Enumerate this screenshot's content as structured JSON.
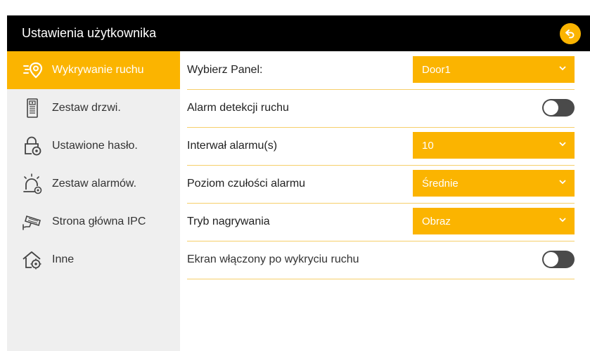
{
  "header": {
    "title": "Ustawienia użytkownika",
    "back_icon": "back-arrow-icon"
  },
  "colors": {
    "accent": "#fbb400",
    "header_bg": "#000000",
    "sidebar_bg": "#efefef",
    "divider": "#f6cf6a",
    "toggle_off": "#4a4a4a"
  },
  "sidebar": {
    "items": [
      {
        "label": "Wykrywanie ruchu",
        "icon": "motion-detection-icon",
        "active": true
      },
      {
        "label": "Zestaw drzwi.",
        "icon": "door-panel-icon",
        "active": false
      },
      {
        "label": "Ustawione hasło.",
        "icon": "lock-settings-icon",
        "active": false
      },
      {
        "label": "Zestaw alarmów.",
        "icon": "alarm-settings-icon",
        "active": false
      },
      {
        "label": "Strona główna IPC",
        "icon": "ipc-camera-icon",
        "active": false
      },
      {
        "label": "Inne",
        "icon": "home-settings-icon",
        "active": false
      }
    ]
  },
  "settings": {
    "panel": {
      "label": "Wybierz Panel:",
      "value": "Door1"
    },
    "motion_alarm": {
      "label": "Alarm detekcji ruchu",
      "enabled": false
    },
    "alarm_interval": {
      "label": "Interwał alarmu(s)",
      "value": "10"
    },
    "sensitivity": {
      "label": "Poziom czułości alarmu",
      "value": "Średnie"
    },
    "record_mode": {
      "label": "Tryb nagrywania",
      "value": "Obraz"
    },
    "screen_on": {
      "label": "Ekran włączony po wykryciu ruchu",
      "enabled": false
    }
  }
}
